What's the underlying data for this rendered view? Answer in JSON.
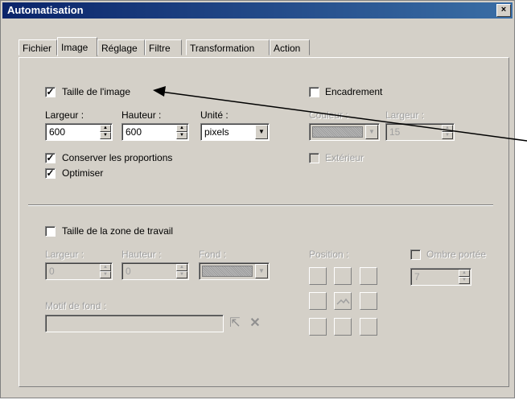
{
  "window": {
    "title": "Automatisation",
    "close_label": "×"
  },
  "tabs": [
    {
      "label": "Fichier"
    },
    {
      "label": "Image"
    },
    {
      "label": "Réglage"
    },
    {
      "label": "Filtre"
    },
    {
      "label": "Transformation"
    },
    {
      "label": "Action"
    }
  ],
  "active_tab": "Image",
  "image_size": {
    "label": "Taille de l'image",
    "checked": true,
    "width_label": "Largeur :",
    "width_value": "600",
    "height_label": "Hauteur :",
    "height_value": "600",
    "unit_label": "Unité :",
    "unit_value": "pixels",
    "keep_proportions_label": "Conserver les proportions",
    "keep_proportions_checked": true,
    "optimize_label": "Optimiser",
    "optimize_checked": true
  },
  "frame": {
    "label": "Encadrement",
    "checked": false,
    "color_label": "Couleur :",
    "width_label": "Largeur :",
    "width_value": "15",
    "outside_label": "Extérieur",
    "outside_checked": false
  },
  "canvas": {
    "label": "Taille de la zone de travail",
    "checked": false,
    "width_label": "Largeur :",
    "width_value": "0",
    "height_label": "Hauteur :",
    "height_value": "0",
    "background_label": "Fond :",
    "position_label": "Position :",
    "pattern_label": "Motif de fond :",
    "pattern_value": "",
    "shadow_label": "Ombre portée",
    "shadow_checked": false,
    "shadow_value": "7"
  },
  "check_mark": "✓",
  "glyphs": {
    "spin_up": "▲",
    "spin_down": "▼",
    "drop": "▼",
    "open": "⇱",
    "delete": "✕"
  }
}
